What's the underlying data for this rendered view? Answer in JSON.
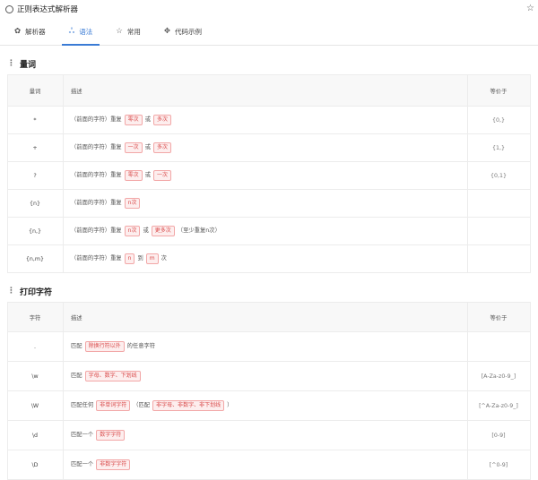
{
  "window": {
    "title": "正则表达式解析器"
  },
  "tabs": [
    {
      "icon": "gear-icon",
      "glyph": "✿",
      "label": "解析器",
      "active": false
    },
    {
      "icon": "share-icon",
      "glyph": "ஃ",
      "label": "语法",
      "active": true
    },
    {
      "icon": "star-icon",
      "glyph": "☆",
      "label": "常用",
      "active": false
    },
    {
      "icon": "code-icon",
      "glyph": "✥",
      "label": "代码示例",
      "active": false
    }
  ],
  "quantifiers": {
    "title": "量词",
    "headers": [
      "量词",
      "描述",
      "等价于"
    ],
    "rows": [
      {
        "sym": "*",
        "pre": "（前面的字符）重复",
        "tag1": "零次",
        "mid": "或",
        "tag2": "多次",
        "post": "",
        "eq": "{0,}"
      },
      {
        "sym": "+",
        "pre": "（前面的字符）重复",
        "tag1": "一次",
        "mid": "或",
        "tag2": "多次",
        "post": "",
        "eq": "{1,}"
      },
      {
        "sym": "?",
        "pre": "（前面的字符）重复",
        "tag1": "零次",
        "mid": "或",
        "tag2": "一次",
        "post": "",
        "eq": "{0,1}"
      },
      {
        "sym": "{n}",
        "pre": "（前面的字符）重复",
        "tag1": "n次",
        "mid": "",
        "tag2": "",
        "post": "",
        "eq": ""
      },
      {
        "sym": "{n,}",
        "pre": "（前面的字符）重复",
        "tag1": "n次",
        "mid": "或",
        "tag2": "更多次",
        "post": "（至少重复n次）",
        "eq": ""
      },
      {
        "sym": "{n,m}",
        "pre": "（前面的字符）重复",
        "tag1": "n",
        "mid": "到",
        "tag2": "m",
        "post": "次",
        "eq": ""
      }
    ]
  },
  "printable": {
    "title": "打印字符",
    "headers": [
      "字符",
      "描述",
      "等价于"
    ],
    "rows": [
      {
        "sym": ".",
        "pre": "匹配",
        "tag1": "除换行符以外",
        "mid": "",
        "tag2": "",
        "post": "的任意字符",
        "eq": ""
      },
      {
        "sym": "\\w",
        "pre": "匹配",
        "tag1": "字母、数字、下划线",
        "mid": "",
        "tag2": "",
        "post": "",
        "eq": "[A-Za-z0-9_]"
      },
      {
        "sym": "\\W",
        "pre": "匹配任何",
        "tag1": "非单词字符",
        "mid": "（匹配",
        "tag2": "非字母、非数字、非下划线",
        "post": "）",
        "eq": "[^A-Za-z0-9_]"
      },
      {
        "sym": "\\d",
        "pre": "匹配一个",
        "tag1": "数字字符",
        "mid": "",
        "tag2": "",
        "post": "",
        "eq": "[0-9]"
      },
      {
        "sym": "\\D",
        "pre": "匹配一个",
        "tag1": "非数字字符",
        "mid": "",
        "tag2": "",
        "post": "",
        "eq": "[^0-9]"
      }
    ]
  }
}
